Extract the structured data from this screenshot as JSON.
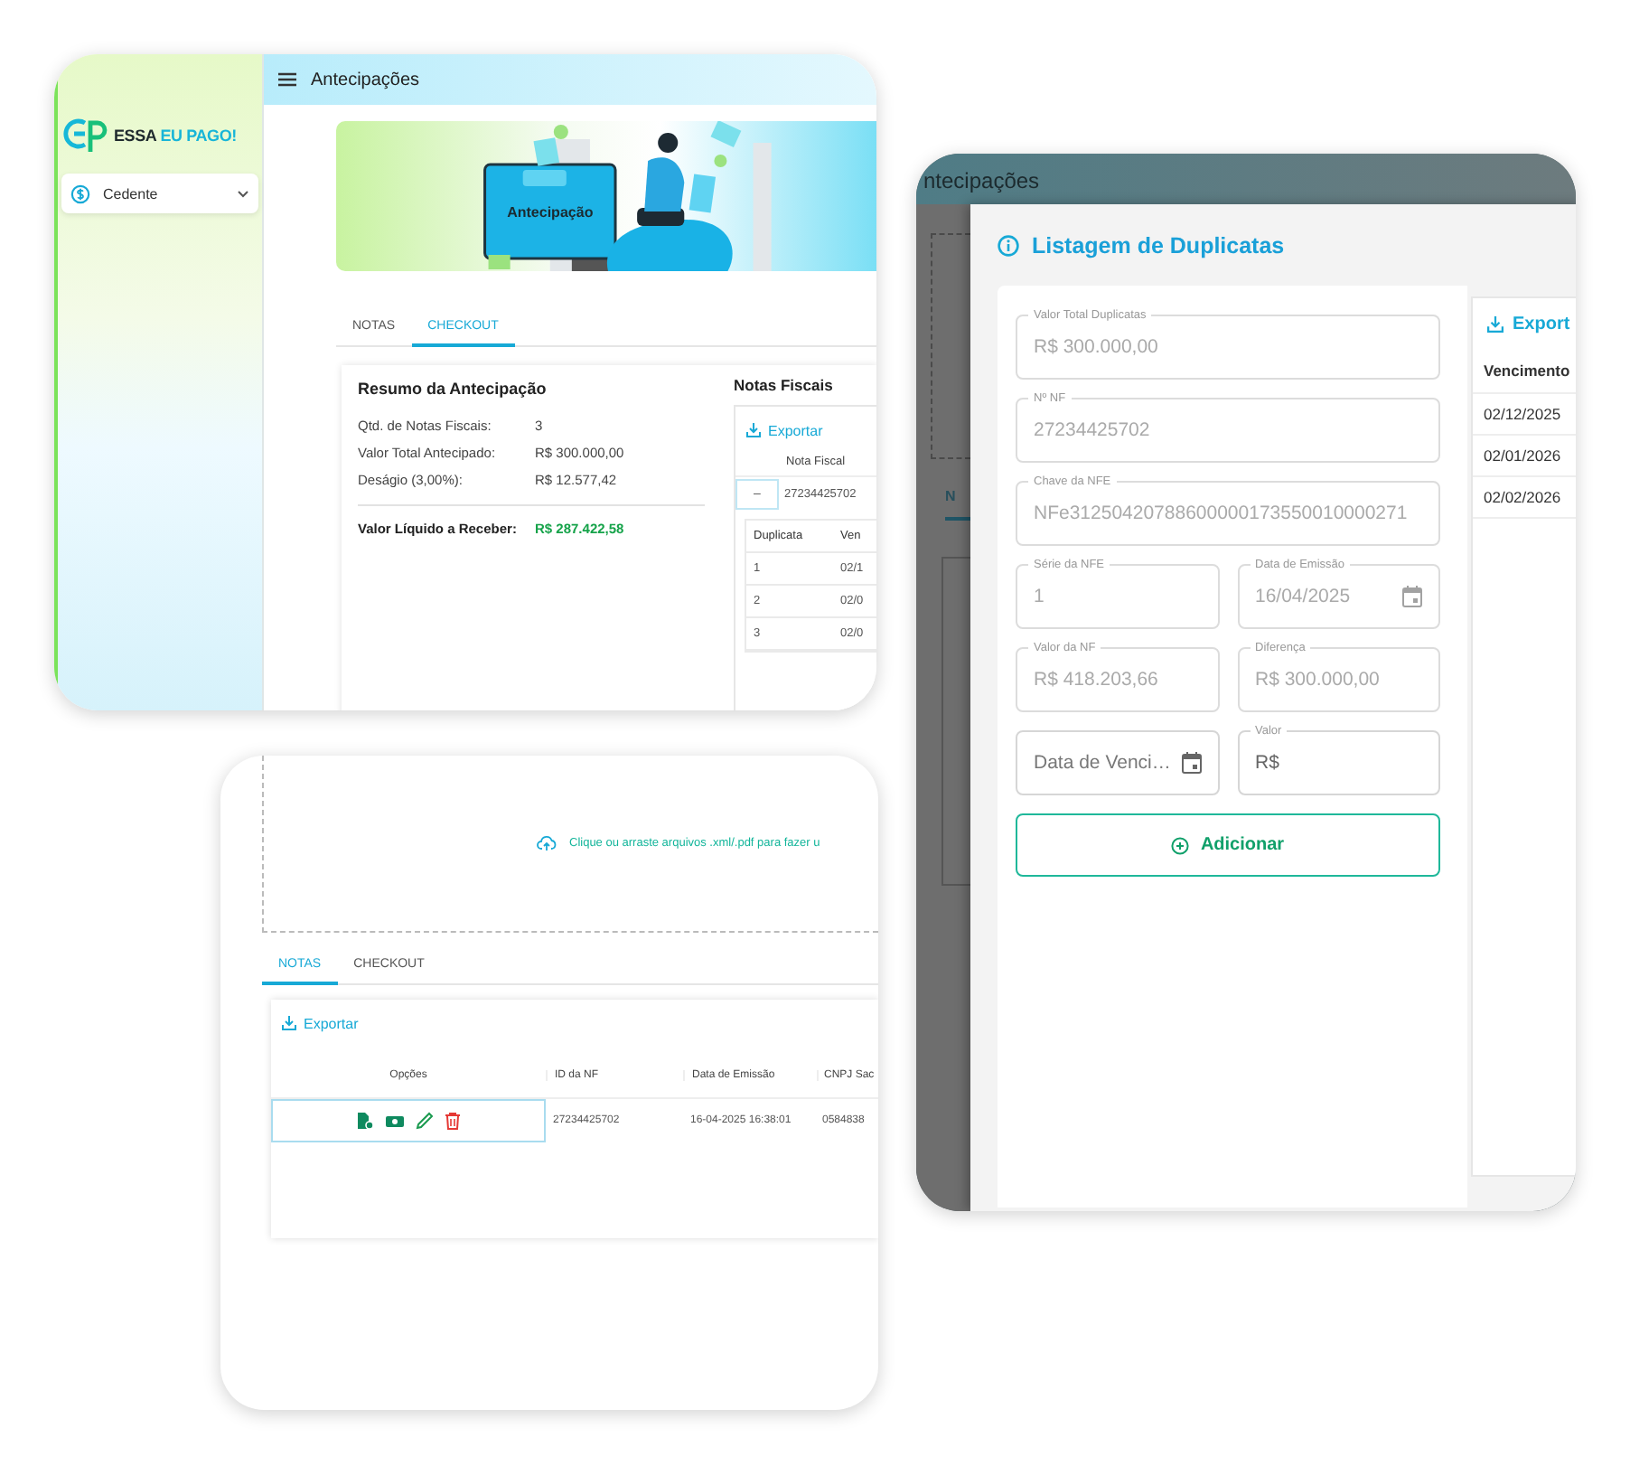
{
  "overview_window": {
    "sidebar": {
      "brand": [
        "ESSA",
        "EU PAGO!"
      ],
      "menu": {
        "label": "Cedente"
      }
    },
    "title": "Antecipações",
    "banner": {
      "caption": "Antecipação"
    },
    "tabs": [
      {
        "label": "NOTAS",
        "selected": false
      },
      {
        "label": "CHECKOUT",
        "selected": true
      }
    ],
    "summary": {
      "title": "Resumo da Antecipação",
      "rows": [
        {
          "label": "Qtd. de Notas Fiscais:",
          "value": "3"
        },
        {
          "label": "Valor Total Antecipado:",
          "value": "R$ 300.000,00"
        },
        {
          "label": "Deságio (3,00%):",
          "value": "R$ 12.577,42"
        }
      ],
      "total": {
        "label": "Valor Líquido a Receber:",
        "value": "R$ 287.422,58"
      }
    },
    "invoices": {
      "title": "Notas Fiscais",
      "export": "Exportar",
      "column": "Nota Fiscal",
      "row": {
        "toggle": "–",
        "id": "27234425702"
      },
      "duplicates": {
        "columns": [
          "Duplicata",
          "Ven"
        ],
        "rows": [
          [
            "1",
            "02/1"
          ],
          [
            "2",
            "02/0"
          ],
          [
            "3",
            "02/0"
          ]
        ]
      }
    }
  },
  "upload_window": {
    "dropzone": {
      "text": "Clique ou arraste arquivos .xml/.pdf para fazer u"
    },
    "tabs": [
      {
        "label": "NOTAS",
        "selected": true
      },
      {
        "label": "CHECKOUT",
        "selected": false
      }
    ],
    "table": {
      "export": "Exportar",
      "actions_column": "Opções",
      "columns": [
        "ID da NF",
        "Data de Emissão",
        "CNPJ Sac"
      ],
      "rows": [
        {
          "actions_focused": true,
          "cells": [
            "27234425702",
            "16-04-2025 16:38:01",
            "0584838"
          ]
        }
      ]
    }
  },
  "dialog_window": {
    "background": {
      "title": "ntecipações",
      "tab": "N"
    },
    "title": "Listagem de Duplicatas",
    "form": {
      "rows": [
        [
          {
            "kind": "text",
            "disabled": true,
            "label": "Valor Total Duplicatas",
            "value": "R$ 300.000,00"
          }
        ],
        [
          {
            "kind": "text",
            "disabled": true,
            "label": "Nº NF",
            "value": "27234425702"
          }
        ],
        [
          {
            "kind": "text",
            "disabled": true,
            "label": "Chave da NFE",
            "value": "NFe31250420788600000173550010000271"
          }
        ],
        [
          {
            "kind": "text",
            "disabled": true,
            "label": "Série da NFE",
            "value": "1"
          },
          {
            "kind": "date",
            "disabled": true,
            "label": "Data de Emissão",
            "value": "16/04/2025"
          }
        ],
        [
          {
            "kind": "text",
            "disabled": true,
            "label": "Valor da NF",
            "value": "R$ 418.203,66"
          },
          {
            "kind": "text",
            "disabled": true,
            "label": "Diferença",
            "value": "R$ 300.000,00"
          }
        ],
        [
          {
            "kind": "date",
            "disabled": false,
            "placeholder": "Data de Venci…"
          },
          {
            "kind": "text",
            "disabled": false,
            "label": "Valor",
            "value": "R$"
          }
        ]
      ],
      "button": "Adicionar"
    },
    "list": {
      "export": "Export",
      "column": "Vencimento",
      "rows": [
        "02/12/2025",
        "02/01/2026",
        "02/02/2026"
      ]
    }
  }
}
